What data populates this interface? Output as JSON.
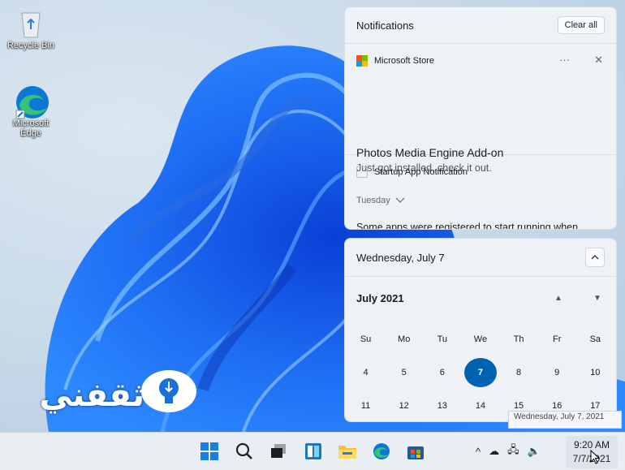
{
  "desktop": {
    "icons": [
      {
        "label": "Recycle Bin",
        "icon": "recycle-bin-icon"
      },
      {
        "label": "Microsoft Edge",
        "icon": "edge-icon"
      }
    ],
    "watermark_text": "ثقفني"
  },
  "notifications": {
    "title": "Notifications",
    "clear_all": "Clear all",
    "items": [
      {
        "app": "Microsoft Store",
        "app_icon": "microsoft-store-icon",
        "more": "···",
        "close": "✕",
        "title": "Photos Media Engine Add-on",
        "body": "Just got installed, check it out."
      },
      {
        "app": "Startup App Notification",
        "app_icon": "startup-app-icon",
        "group": "Tuesday",
        "body": "Some apps were registered to start running when"
      }
    ]
  },
  "calendar": {
    "date_header": "Wednesday, July 7",
    "collapse": "^",
    "month": "July 2021",
    "prev": "▲",
    "next": "▼",
    "weekdays": [
      "Su",
      "Mo",
      "Tu",
      "We",
      "Th",
      "Fr",
      "Sa"
    ],
    "weeks": [
      [
        "4",
        "5",
        "6",
        "7",
        "8",
        "9",
        "10"
      ],
      [
        "11",
        "12",
        "13",
        "14",
        "15",
        "16",
        "17"
      ]
    ],
    "selected": "7",
    "accent": "#0063b1"
  },
  "tooltip": "Wednesday, July 7, 2021",
  "taskbar": {
    "apps": [
      "start-icon",
      "search-icon",
      "task-view-icon",
      "widgets-icon",
      "file-explorer-icon",
      "edge-icon",
      "microsoft-store-icon"
    ],
    "tray": {
      "chevron": "^",
      "onedrive": "☁",
      "network": "🖧",
      "volume": "🔈"
    },
    "time": "9:20 AM",
    "date": "7/7/2021"
  }
}
